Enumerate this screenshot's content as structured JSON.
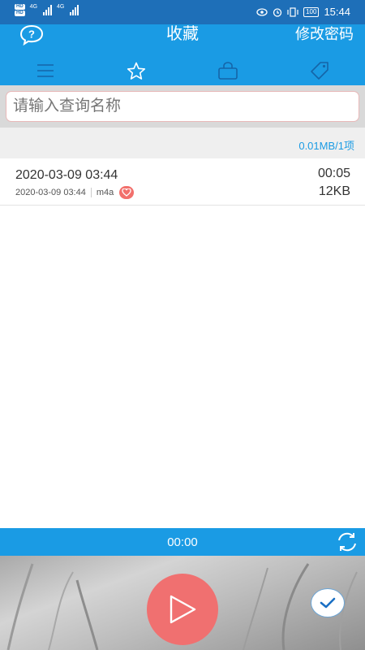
{
  "status_bar": {
    "network_1": "4G",
    "network_2": "4G",
    "battery": "100",
    "time": "15:44"
  },
  "header": {
    "title": "收藏",
    "change_password": "修改密码"
  },
  "tabs": [
    {
      "icon": "menu-icon"
    },
    {
      "icon": "star-icon"
    },
    {
      "icon": "lock-icon"
    },
    {
      "icon": "tag-icon"
    }
  ],
  "search": {
    "placeholder": "请输入查询名称"
  },
  "summary": "0.01MB/1项",
  "recordings": [
    {
      "title": "2020-03-09 03:44",
      "date": "2020-03-09 03:44",
      "format": "m4a",
      "duration": "00:05",
      "size": "12KB"
    }
  ],
  "player": {
    "time": "00:00"
  },
  "colors": {
    "status_bar": "#1E6FB8",
    "header": "#1A9BE4",
    "play_button": "#F07070",
    "accent_text": "#1A9BE4"
  }
}
